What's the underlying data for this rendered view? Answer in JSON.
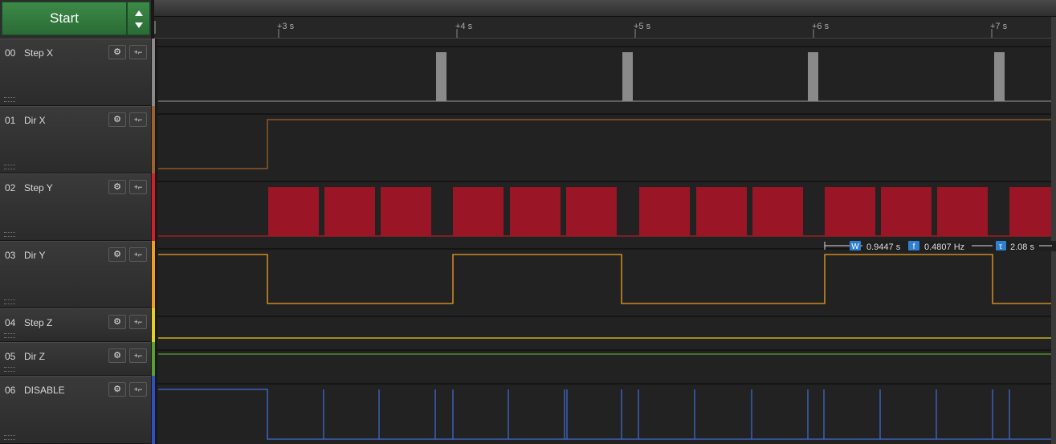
{
  "start_label": "Start",
  "ruler": {
    "ticks": [
      {
        "label": "+3 s"
      },
      {
        "label": "+4 s"
      },
      {
        "label": "+5 s"
      },
      {
        "label": "+6 s"
      },
      {
        "label": "+7 s"
      }
    ]
  },
  "channels": [
    {
      "num": "00",
      "name": "Step X",
      "color": "#8a8a8a"
    },
    {
      "num": "01",
      "name": "Dir X",
      "color": "#a0612a"
    },
    {
      "num": "02",
      "name": "Step Y",
      "color": "#d0202a"
    },
    {
      "num": "03",
      "name": "Dir Y",
      "color": "#f0a020"
    },
    {
      "num": "04",
      "name": "Step Z",
      "color": "#e8d020"
    },
    {
      "num": "05",
      "name": "Dir Z",
      "color": "#5aa030"
    },
    {
      "num": "06",
      "name": "DISABLE",
      "color": "#3050c0"
    }
  ],
  "measurement": {
    "width_icon": "W",
    "width_value": "0.9447 s",
    "freq_icon": "f",
    "freq_value": "0.4807 Hz",
    "period_icon": "τ",
    "period_value": "2.08 s"
  },
  "icons": {
    "settings": "gear-icon",
    "trigger": "trigger-icon"
  }
}
